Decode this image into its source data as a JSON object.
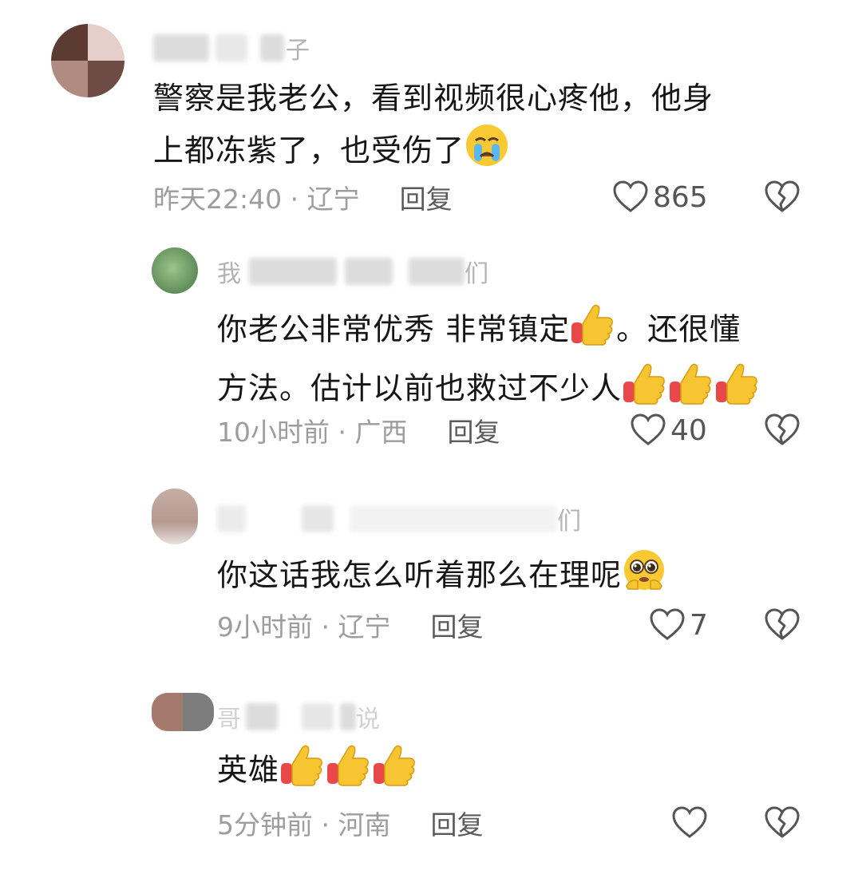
{
  "comments": [
    {
      "name_visible_start": "",
      "name_visible_end": "子",
      "text_line1": "警察是我老公，看到视频很心疼他，他身",
      "text_line2": "上都冻紫了，也受伤了",
      "time_location": "昨天22:40 · 辽宁",
      "reply_label": "回复",
      "likes": "865",
      "emoji": "crying-face-icon"
    },
    {
      "name_visible_start": "我",
      "name_visible_end": "们",
      "text_line1": "你老公非常优秀 非常镇定",
      "text_line1b": "。还很懂",
      "text_line2": "方法。估计以前也救过不少人",
      "time_location": "10小时前 · 广西",
      "reply_label": "回复",
      "likes": "40",
      "emoji": "thumbs-up-icon"
    },
    {
      "name_visible_start": "",
      "name_visible_end": "们",
      "text_line1": "你这话我怎么听着那么在理呢",
      "time_location": "9小时前 · 辽宁",
      "reply_label": "回复",
      "likes": "7",
      "emoji": "pleading-face-icon"
    },
    {
      "name_visible_start": "哥",
      "name_visible_end": "说",
      "text_line1": "英雄",
      "time_location": "5分钟前 · 河南",
      "reply_label": "回复",
      "likes": "",
      "emoji": "thumbs-up-icon"
    }
  ],
  "colors": {
    "text": "#161616",
    "meta": "#9d9d9d",
    "thumb_yellow": "#f7c531",
    "thumb_cuff": "#e8484a",
    "icon_stroke": "#555555"
  }
}
